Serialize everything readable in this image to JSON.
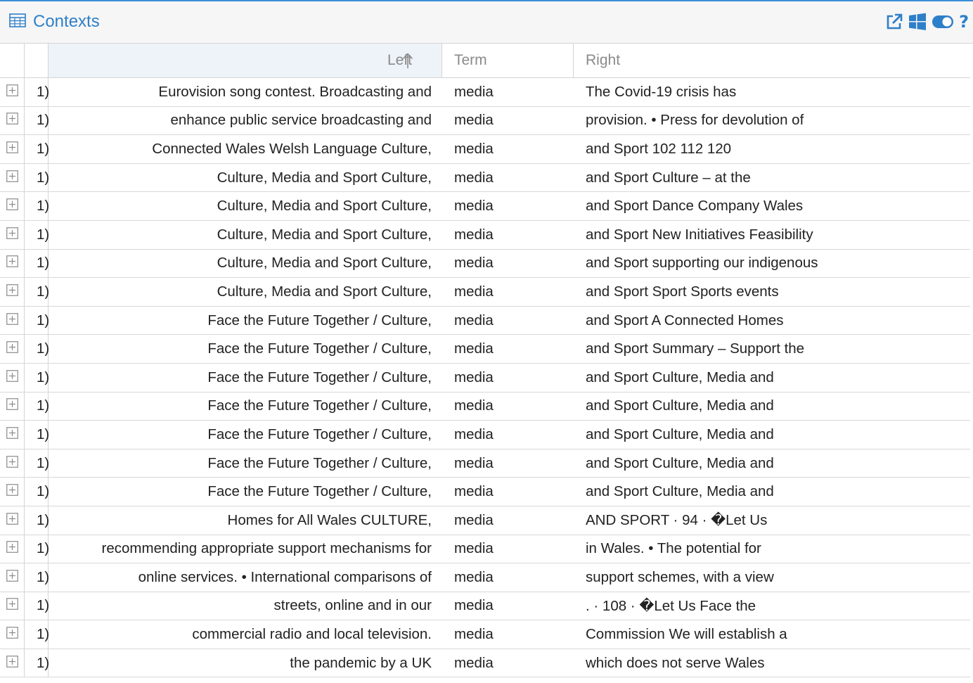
{
  "panel": {
    "title": "Contexts",
    "title_icon": "table-icon",
    "accent_color": "#2e7fc9",
    "tools": [
      "external-link-icon",
      "windows-icon",
      "toggle-icon",
      "help-icon"
    ],
    "help_label": "?"
  },
  "columns": {
    "left": "Left",
    "term": "Term",
    "right": "Right",
    "sorted_by": "Left",
    "sort_direction": "ascending"
  },
  "rows": [
    {
      "num": "1)",
      "left": "Eurovision song contest. Broadcasting and",
      "term": "media",
      "right": "The Covid-19 crisis has"
    },
    {
      "num": "1)",
      "left": "enhance public service broadcasting and",
      "term": "media",
      "right": "provision. • Press for devolution of"
    },
    {
      "num": "1)",
      "left": "Connected Wales Welsh Language Culture,",
      "term": "media",
      "right": "and Sport 102 112 120"
    },
    {
      "num": "1)",
      "left": "Culture, Media and Sport Culture,",
      "term": "media",
      "right": "and Sport Culture – at the"
    },
    {
      "num": "1)",
      "left": "Culture, Media and Sport Culture,",
      "term": "media",
      "right": "and Sport Dance Company Wales"
    },
    {
      "num": "1)",
      "left": "Culture, Media and Sport Culture,",
      "term": "media",
      "right": "and Sport New Initiatives Feasibility"
    },
    {
      "num": "1)",
      "left": "Culture, Media and Sport Culture,",
      "term": "media",
      "right": "and Sport supporting our indigenous"
    },
    {
      "num": "1)",
      "left": "Culture, Media and Sport Culture,",
      "term": "media",
      "right": "and Sport Sport Sports events"
    },
    {
      "num": "1)",
      "left": "Face the Future Together / Culture,",
      "term": "media",
      "right": "and Sport A Connected Homes"
    },
    {
      "num": "1)",
      "left": "Face the Future Together / Culture,",
      "term": "media",
      "right": "and Sport Summary – Support the"
    },
    {
      "num": "1)",
      "left": "Face the Future Together / Culture,",
      "term": "media",
      "right": "and Sport Culture, Media and"
    },
    {
      "num": "1)",
      "left": "Face the Future Together / Culture,",
      "term": "media",
      "right": "and Sport Culture, Media and"
    },
    {
      "num": "1)",
      "left": "Face the Future Together / Culture,",
      "term": "media",
      "right": "and Sport Culture, Media and"
    },
    {
      "num": "1)",
      "left": "Face the Future Together / Culture,",
      "term": "media",
      "right": "and Sport Culture, Media and"
    },
    {
      "num": "1)",
      "left": "Face the Future Together / Culture,",
      "term": "media",
      "right": "and Sport Culture, Media and"
    },
    {
      "num": "1)",
      "left": "Homes for All Wales CULTURE,",
      "term": "media",
      "right": "AND SPORT · 94 · �Let Us"
    },
    {
      "num": "1)",
      "left": "recommending appropriate support mechanisms for",
      "term": "media",
      "right": "in Wales. • The potential for"
    },
    {
      "num": "1)",
      "left": "online services. • International comparisons of",
      "term": "media",
      "right": "support schemes, with a view"
    },
    {
      "num": "1)",
      "left": "streets, online and in our",
      "term": "media",
      "right": ". · 108 · �Let Us Face the"
    },
    {
      "num": "1)",
      "left": "commercial radio and local television.",
      "term": "media",
      "right": "Commission We will establish a"
    },
    {
      "num": "1)",
      "left": "the pandemic by a UK",
      "term": "media",
      "right": "which does not serve Wales"
    }
  ]
}
